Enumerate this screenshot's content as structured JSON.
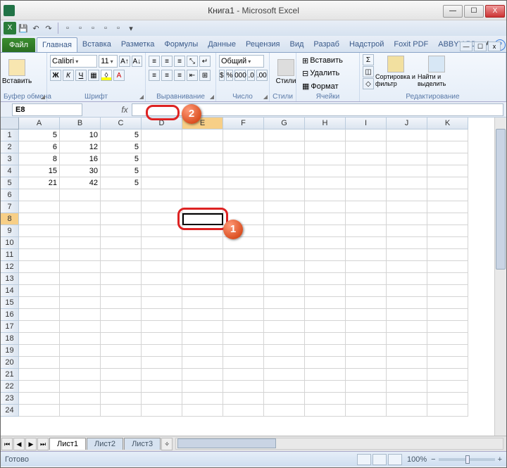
{
  "title": {
    "doc": "Книга1",
    "app": "Microsoft Excel"
  },
  "winbtns": {
    "min": "—",
    "max": "☐",
    "close": "X"
  },
  "tabs": {
    "file": "Файл",
    "items": [
      "Главная",
      "Вставка",
      "Разметка",
      "Формулы",
      "Данные",
      "Рецензия",
      "Вид",
      "Разраб",
      "Надстрой",
      "Foxit PDF",
      "ABBYY PD"
    ],
    "activeIndex": 0
  },
  "ribbon": {
    "clipboard": {
      "paste": "Вставить",
      "label": "Буфер обмена"
    },
    "font": {
      "name": "Calibri",
      "size": "11",
      "label": "Шрифт",
      "bold": "Ж",
      "italic": "К",
      "underline": "Ч"
    },
    "align": {
      "label": "Выравнивание"
    },
    "number": {
      "format": "Общий",
      "label": "Число"
    },
    "styles": {
      "btn": "Стили",
      "label": "Стили"
    },
    "cells": {
      "insert": "Вставить",
      "delete": "Удалить",
      "format": "Формат",
      "label": "Ячейки"
    },
    "editing": {
      "sort": "Сортировка и фильтр",
      "find": "Найти и выделить",
      "label": "Редактирование"
    }
  },
  "namebox": "E8",
  "fx": "fx",
  "cols": [
    "A",
    "B",
    "C",
    "D",
    "E",
    "F",
    "G",
    "H",
    "I",
    "J",
    "K"
  ],
  "rowCount": 24,
  "selectedCol": 4,
  "selectedRow": 8,
  "cells": {
    "1": {
      "A": "5",
      "B": "10",
      "C": "5"
    },
    "2": {
      "A": "6",
      "B": "12",
      "C": "5"
    },
    "3": {
      "A": "8",
      "B": "16",
      "C": "5"
    },
    "4": {
      "A": "15",
      "B": "30",
      "C": "5"
    },
    "5": {
      "A": "21",
      "B": "42",
      "C": "5"
    }
  },
  "sheets": {
    "items": [
      "Лист1",
      "Лист2",
      "Лист3"
    ],
    "activeIndex": 0
  },
  "status": {
    "ready": "Готово",
    "zoom": "100%"
  },
  "callouts": {
    "n1": "1",
    "n2": "2"
  }
}
